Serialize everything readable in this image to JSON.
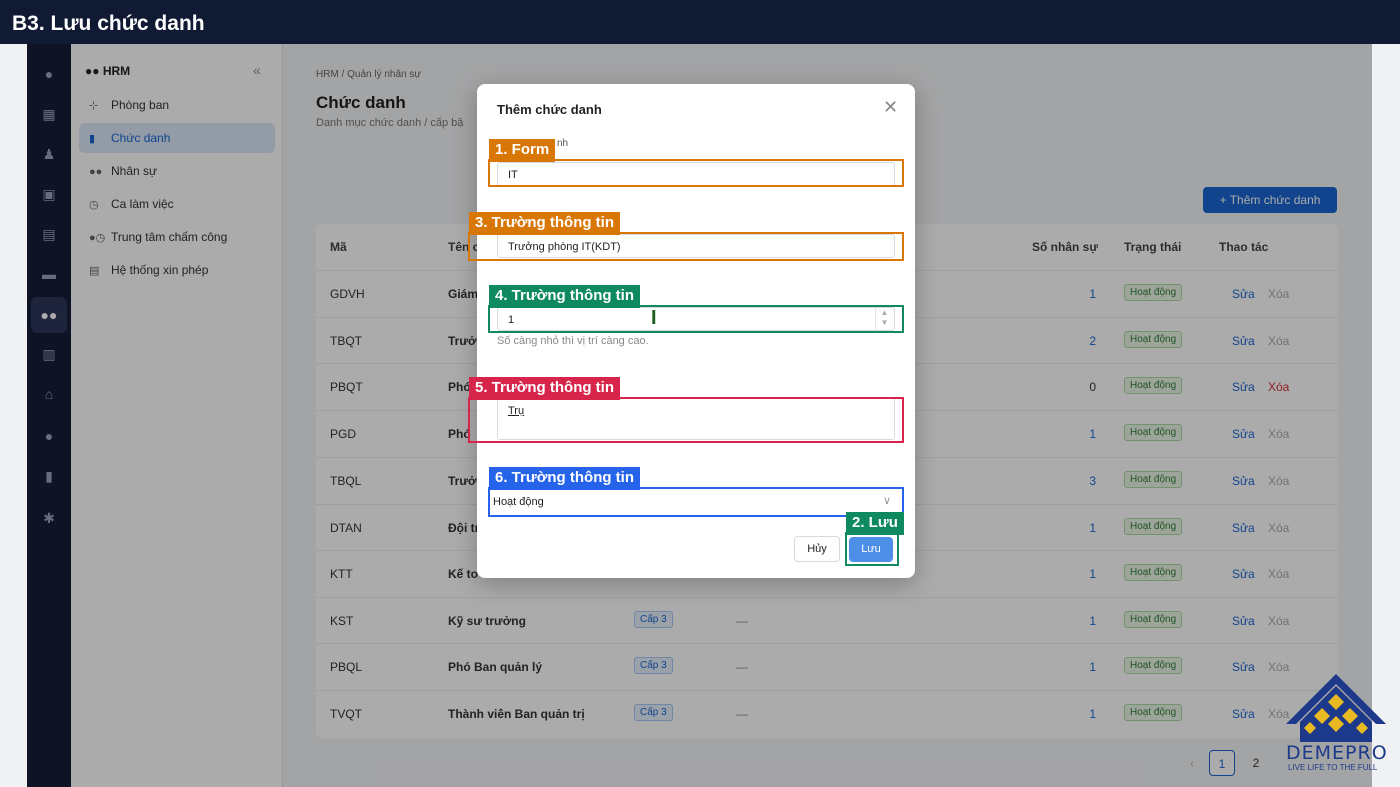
{
  "step_title": "B3. Lưu chức danh",
  "sidebar": {
    "head": "HRM",
    "items": [
      {
        "label": "Phòng ban",
        "icon": "sitemap-icon"
      },
      {
        "label": "Chức danh",
        "icon": "id-badge-icon"
      },
      {
        "label": "Nhân sự",
        "icon": "users-icon"
      },
      {
        "label": "Ca làm việc",
        "icon": "clock-icon"
      },
      {
        "label": "Trung tâm chấm công",
        "icon": "user-clock-icon"
      },
      {
        "label": "Hệ thống xin phép",
        "icon": "file-sign-icon"
      }
    ]
  },
  "breadcrumb": "HRM  /  Quản lý nhân sự",
  "page": {
    "title": "Chức danh",
    "subtitle": "Danh mục chức danh / cấp bậ",
    "add_button": "+  Thêm chức danh"
  },
  "table": {
    "headers": [
      "Mã",
      "Tên c",
      "Số nhân sự",
      "Trạng thái",
      "Thao tác"
    ],
    "rows": [
      {
        "code": "GDVH",
        "name": "Giám",
        "count": "1",
        "status": "Hoạt động",
        "edit": "Sửa",
        "delete": "Xóa"
      },
      {
        "code": "TBQT",
        "name": "Trưở",
        "count": "2",
        "status": "Hoạt động",
        "edit": "Sửa",
        "delete": "Xóa"
      },
      {
        "code": "PBQT",
        "name": "Phó",
        "count": "0",
        "status": "Hoạt động",
        "edit": "Sửa",
        "delete": "Xóa"
      },
      {
        "code": "PGD",
        "name": "Phó",
        "count": "1",
        "status": "Hoạt động",
        "edit": "Sửa",
        "delete": "Xóa"
      },
      {
        "code": "TBQL",
        "name": "Trưở",
        "count": "3",
        "status": "Hoạt động",
        "edit": "Sửa",
        "delete": "Xóa"
      },
      {
        "code": "DTAN",
        "name": "Đội tr",
        "count": "1",
        "status": "Hoạt động",
        "edit": "Sửa",
        "delete": "Xóa"
      },
      {
        "code": "KTT",
        "name": "Kế to",
        "count": "1",
        "status": "Hoạt động",
        "edit": "Sửa",
        "delete": "Xóa"
      },
      {
        "code": "KST",
        "name": "Kỹ sư trưởng",
        "level": "Cấp 3",
        "dash": "—",
        "count": "1",
        "status": "Hoạt động",
        "edit": "Sửa",
        "delete": "Xóa"
      },
      {
        "code": "PBQL",
        "name": "Phó Ban quản lý",
        "level": "Cấp 3",
        "dash": "—",
        "count": "1",
        "status": "Hoạt động",
        "edit": "Sửa",
        "delete": "Xóa"
      },
      {
        "code": "TVQT",
        "name": "Thành viên Ban quản trị",
        "level": "Cấp 3",
        "dash": "—",
        "count": "1",
        "status": "Hoạt động",
        "edit": "Sửa",
        "delete": "Xóa"
      }
    ]
  },
  "pagination": {
    "prev": "‹",
    "pages": [
      "1",
      "2"
    ]
  },
  "modal": {
    "title": "Thêm chức danh",
    "label_fragment": "nh",
    "code_value": "IT",
    "name_value": "Trưởng phòng IT(KDT)",
    "order_value": "1",
    "order_help": "Số càng nhỏ thì vị trí càng cao.",
    "desc_value": "Trụ",
    "status_value": "Hoạt động",
    "cancel_label": "Hủy",
    "save_label": "Lưu"
  },
  "annotations": {
    "tag1": "1. Form",
    "tag2": "2. Lưu",
    "tag3": "3. Trường thông tin",
    "tag4": "4. Trường thông tin",
    "tag5": "5. Trường thông tin",
    "tag6": "6. Trường thông tin"
  },
  "logo": {
    "name": "DEMEPRO",
    "tagline": "LIVE LIFE TO THE FULL"
  },
  "colors": {
    "primary": "#1a66d2",
    "orange": "#d97706",
    "green": "#0f8a5f",
    "red": "#d6244a",
    "blue": "#2563eb"
  }
}
